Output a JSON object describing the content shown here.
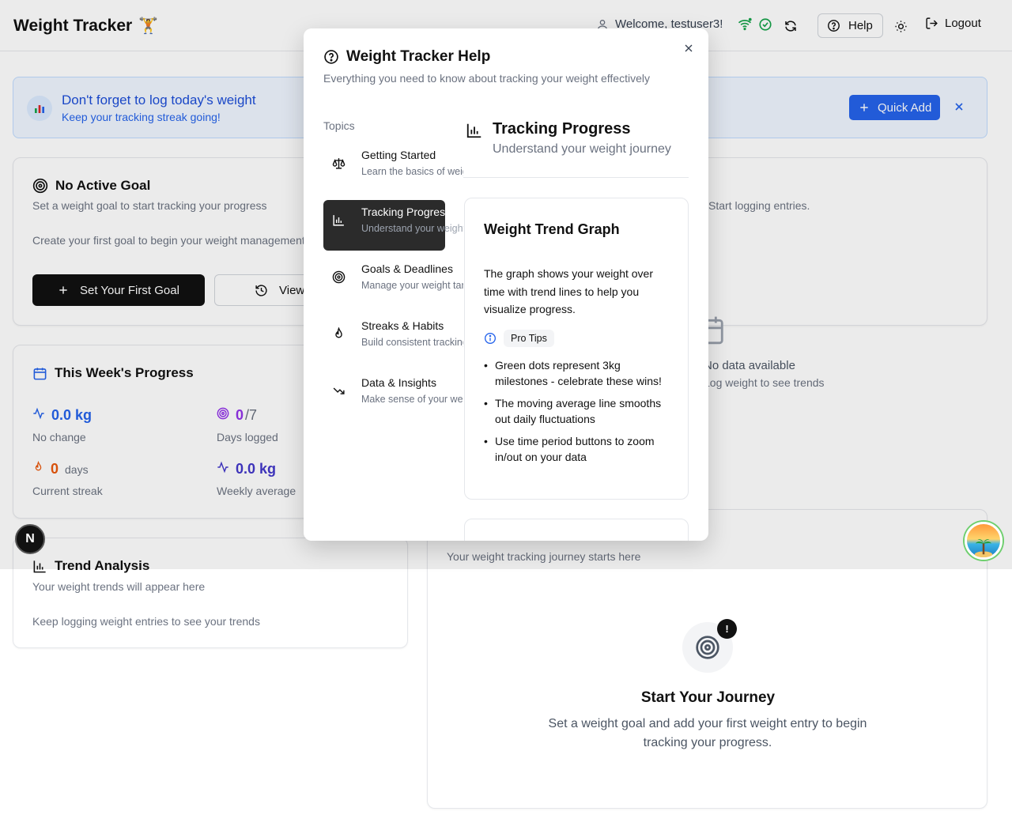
{
  "header": {
    "app_title": "Weight Tracker",
    "app_emoji": "🏋️",
    "welcome": "Welcome, testuser3!",
    "help_label": "Help",
    "logout_label": "Logout"
  },
  "banner": {
    "title": "Don't forget to log today's weight",
    "subtitle": "Keep your tracking streak going!",
    "quick_add_label": "Quick Add"
  },
  "goal_card": {
    "title": "No Active Goal",
    "subtitle": "Set a weight goal to start tracking your progress",
    "body": "Create your first goal to begin your weight management journey.",
    "primary_button": "Set Your First Goal",
    "secondary_button": "View History",
    "right_text": "Start logging entries."
  },
  "chart_empty": {
    "title": "No data available",
    "subtitle": "Log weight to see trends"
  },
  "week_card": {
    "title": "This Week's Progress",
    "stats": [
      {
        "value": "0.0 kg",
        "suffix": "",
        "label": "No change"
      },
      {
        "value": "0",
        "suffix": "/7",
        "label": "Days logged"
      },
      {
        "value": "0",
        "suffix": "days",
        "label": "Current streak"
      },
      {
        "value": "0.0 kg",
        "suffix": "",
        "label": "Weekly average"
      }
    ]
  },
  "trend_card": {
    "title": "Trend Analysis",
    "subtitle": "Your weight trends will appear here",
    "body": "Keep logging weight entries to see your trends"
  },
  "journey_card": {
    "subtitle": "Your weight tracking journey starts here",
    "badge": "!",
    "title": "Start Your Journey",
    "text": "Set a weight goal and add your first weight entry to begin tracking your progress."
  },
  "n_badge": "N",
  "modal": {
    "title": "Weight Tracker Help",
    "subtitle": "Everything you need to know about tracking your weight effectively",
    "topics_heading": "Topics",
    "topics": [
      {
        "label": "Getting Started",
        "desc": "Learn the basics of weight tracking",
        "icon": "scale-icon"
      },
      {
        "label": "Tracking Progress",
        "desc": "Understand your weight journey",
        "icon": "bar-chart-icon"
      },
      {
        "label": "Goals & Deadlines",
        "desc": "Manage your weight targets",
        "icon": "target-icon"
      },
      {
        "label": "Streaks & Habits",
        "desc": "Build consistent tracking habits",
        "icon": "flame-icon"
      },
      {
        "label": "Data & Insights",
        "desc": "Make sense of your weight data",
        "icon": "trending-down-icon"
      }
    ],
    "active_topic": "Tracking Progress",
    "content": {
      "title": "Tracking Progress",
      "subtitle": "Understand your weight journey",
      "card_title": "Weight Trend Graph",
      "card_text": "The graph shows your weight over time with trend lines to help you visualize progress.",
      "tips_label": "Pro Tips",
      "tips": [
        "Green dots represent 3kg milestones - celebrate these wins!",
        "The moving average line smooths out daily fluctuations",
        "Use time period buttons to zoom in/out on your data"
      ]
    }
  },
  "colors": {
    "accent": "#2563eb",
    "dark": "#111111",
    "success": "#16a34a",
    "streak": "#ea580c",
    "purple": "#9333ea"
  }
}
